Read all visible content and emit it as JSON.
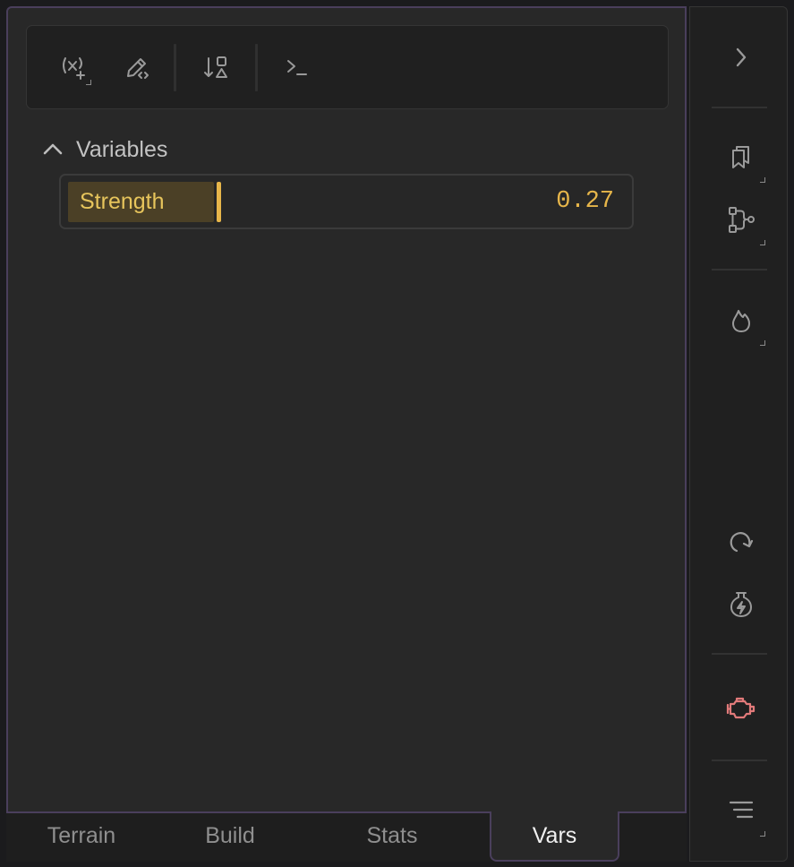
{
  "toolbar": {
    "buttons": [
      {
        "name": "new-variable-icon",
        "has_submenu": true
      },
      {
        "name": "edit-code-icon",
        "has_submenu": false
      },
      {
        "name": "sort-shapes-icon",
        "has_submenu": false
      },
      {
        "name": "terminal-icon",
        "has_submenu": false
      }
    ]
  },
  "variables_section": {
    "title": "Variables",
    "expanded": true,
    "items": [
      {
        "label": "Strength",
        "value": "0.27",
        "fraction": 0.27
      }
    ]
  },
  "tabs": [
    {
      "label": "Terrain",
      "active": false
    },
    {
      "label": "Build",
      "active": false
    },
    {
      "label": "Stats",
      "active": false
    },
    {
      "label": "Vars",
      "active": true
    }
  ],
  "dock": {
    "buttons": [
      "chevron-right-icon",
      "bookmarks-icon",
      "node-graph-icon",
      "flame-icon",
      "redo-arrow-icon",
      "flask-bolt-icon",
      "engine-icon",
      "menu-lines-icon"
    ],
    "engine_color": "#e27a7a",
    "icon_color": "#9a9a9a"
  },
  "colors": {
    "accent": "#e7b64a",
    "label_text": "#e7c55c",
    "panel_border": "#4a3f5c",
    "panel_bg": "#282828"
  }
}
